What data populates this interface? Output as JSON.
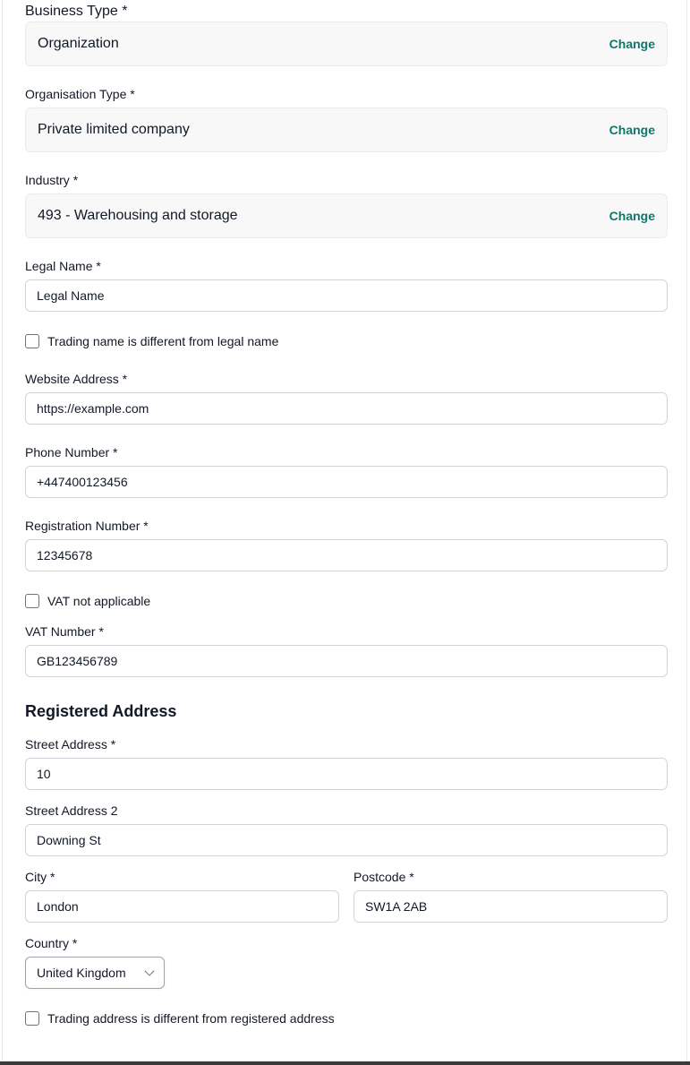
{
  "business_type": {
    "label": "Business Type *",
    "value": "Organization",
    "change": "Change"
  },
  "organisation_type": {
    "label": "Organisation Type *",
    "value": "Private limited company",
    "change": "Change"
  },
  "industry": {
    "label": "Industry *",
    "value": "493 - Warehousing and storage",
    "change": "Change"
  },
  "legal_name": {
    "label": "Legal Name *",
    "value": "Legal Name"
  },
  "trading_name_check": {
    "label": "Trading name is different from legal name"
  },
  "website": {
    "label": "Website Address *",
    "value": "https://example.com"
  },
  "phone": {
    "label": "Phone Number *",
    "value": "+447400123456"
  },
  "registration": {
    "label": "Registration Number *",
    "value": "12345678"
  },
  "vat_check": {
    "label": "VAT not applicable"
  },
  "vat": {
    "label": "VAT Number *",
    "value": "GB123456789"
  },
  "registered_address": {
    "title": "Registered Address",
    "street1": {
      "label": "Street Address *",
      "value": "10"
    },
    "street2": {
      "label": "Street Address 2",
      "value": "Downing St"
    },
    "city": {
      "label": "City *",
      "value": "London"
    },
    "postcode": {
      "label": "Postcode *",
      "value": "SW1A 2AB"
    },
    "country": {
      "label": "Country *",
      "value": "United Kingdom"
    }
  },
  "trading_address_check": {
    "label": "Trading address is different from registered address"
  }
}
